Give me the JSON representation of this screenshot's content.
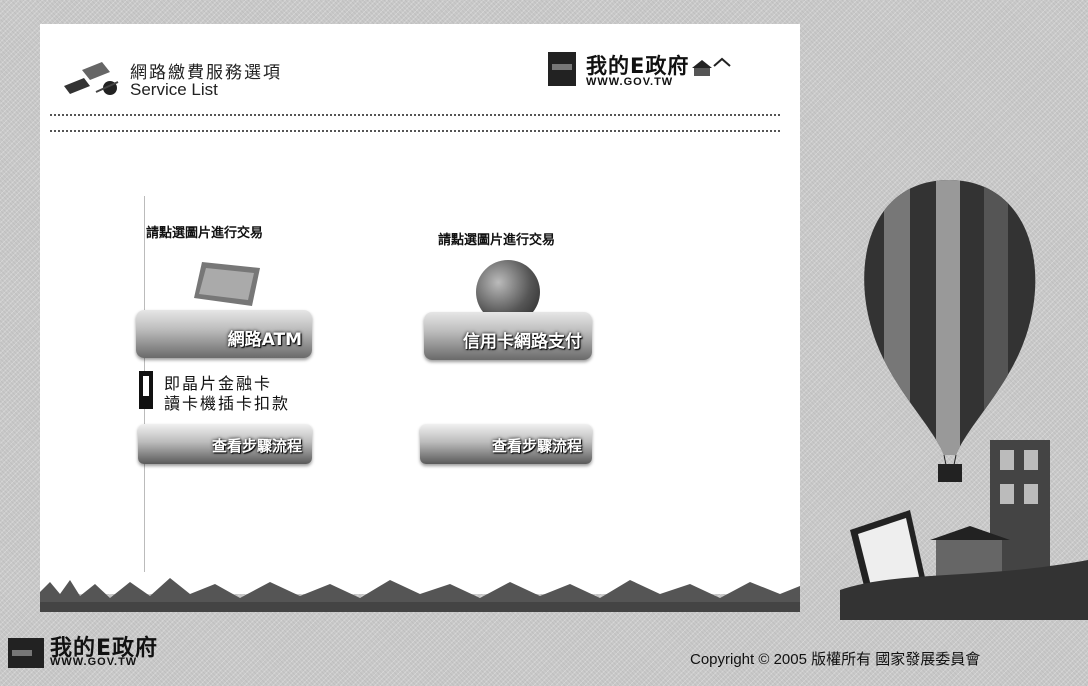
{
  "header": {
    "title_zh": "網路繳費服務選項",
    "title_en": "Service List"
  },
  "brand": {
    "name_zh": "我的E政府",
    "url": "WWW.GOV.TW"
  },
  "services": [
    {
      "prompt": "請點選圖片進行交易",
      "button_label": "網路ATM"
    },
    {
      "prompt": "請點選圖片進行交易",
      "button_label": "信用卡網路支付"
    }
  ],
  "card_reader": {
    "line1": "即晶片金融卡",
    "line2": "讀卡機插卡扣款"
  },
  "steps": [
    {
      "label": "查看步驟流程"
    },
    {
      "label": "查看步驟流程"
    }
  ],
  "footer": {
    "copyright": "Copyright © 2005 版權所有 國家發展委員會"
  },
  "colors": {
    "background": "#c9c9c9",
    "card": "#ffffff",
    "brand_dark": "#222222"
  }
}
